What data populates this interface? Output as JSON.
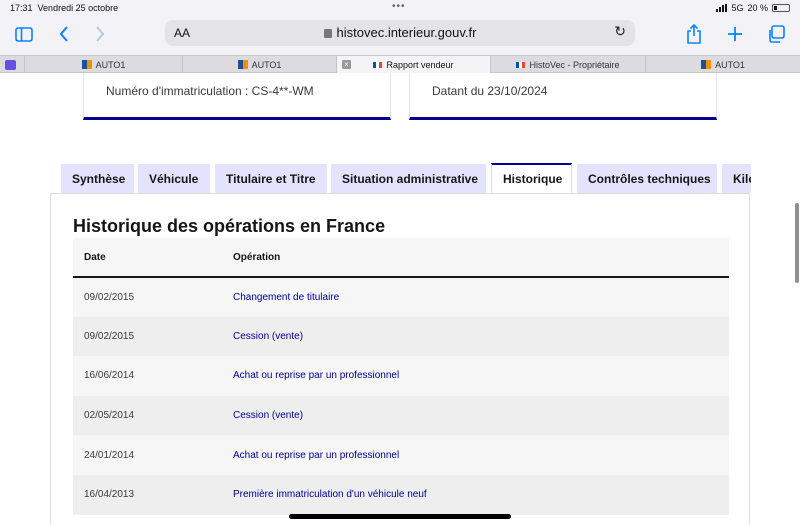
{
  "status": {
    "time": "17:31",
    "date": "Vendredi 25 octobre",
    "network": "5G",
    "battery": "20 %"
  },
  "toolbar": {
    "text_size_label": "AA",
    "url": "histovec.interieur.gouv.fr"
  },
  "tabs": [
    {
      "label": "AUTO1",
      "icon": "auto1-favicon"
    },
    {
      "label": "AUTO1",
      "icon": "auto1-favicon"
    },
    {
      "label": "Rapport vendeur",
      "icon": "france-flag-favicon",
      "active": true
    },
    {
      "label": "HistoVec - Propriétaire",
      "icon": "france-flag-favicon"
    },
    {
      "label": "AUTO1",
      "icon": "auto1-favicon"
    }
  ],
  "cards": {
    "registration": "Numéro d'immatriculation : CS-4**-WM",
    "dated": "Datant du 23/10/2024"
  },
  "page_tabs": [
    {
      "label": "Synthèse"
    },
    {
      "label": "Véhicule"
    },
    {
      "label": "Titulaire et Titre"
    },
    {
      "label": "Situation administrative"
    },
    {
      "label": "Historique",
      "active": true
    },
    {
      "label": "Contrôles techniques"
    },
    {
      "label": "Kilo"
    }
  ],
  "history": {
    "title": "Historique des opérations en France",
    "columns": [
      "Date",
      "Opération"
    ],
    "rows": [
      {
        "date": "09/02/2015",
        "operation": "Changement de titulaire"
      },
      {
        "date": "09/02/2015",
        "operation": "Cession (vente)"
      },
      {
        "date": "16/06/2014",
        "operation": "Achat ou reprise par un professionnel"
      },
      {
        "date": "02/05/2014",
        "operation": "Cession (vente)"
      },
      {
        "date": "24/01/2014",
        "operation": "Achat ou reprise par un professionnel"
      },
      {
        "date": "16/04/2013",
        "operation": "Première immatriculation d'un véhicule neuf"
      }
    ]
  },
  "colors": {
    "accent": "#000091",
    "browser_accent": "#0a84ff",
    "tab_inactive": "#e3e3fd"
  }
}
